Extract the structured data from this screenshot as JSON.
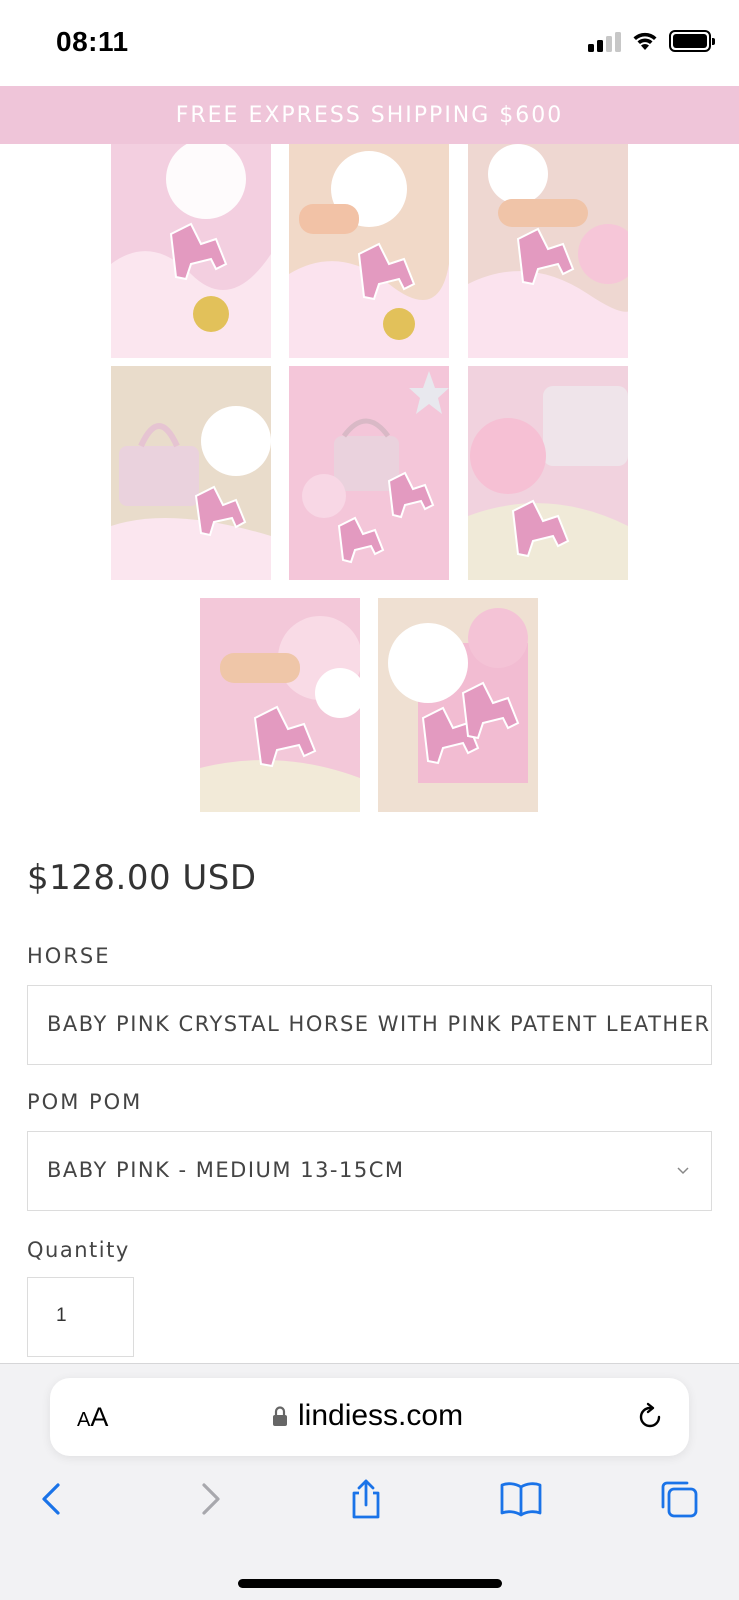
{
  "status_bar": {
    "time": "08:11"
  },
  "announcement": {
    "text": "FREE EXPRESS SHIPPING $600"
  },
  "gallery": {
    "images": [
      {
        "name": "product-image-1"
      },
      {
        "name": "product-image-2"
      },
      {
        "name": "product-image-3"
      },
      {
        "name": "product-image-4"
      },
      {
        "name": "product-image-5"
      },
      {
        "name": "product-image-6"
      },
      {
        "name": "product-image-7"
      },
      {
        "name": "product-image-8"
      }
    ]
  },
  "product": {
    "price": "$128.00 USD",
    "horse_label": "HORSE",
    "horse_value": "BABY PINK CRYSTAL HORSE WITH PINK PATENT LEATHER",
    "pompom_label": "POM POM",
    "pompom_value": "BABY PINK - MEDIUM 13-15CM",
    "quantity_label": "Quantity",
    "quantity_value": "1"
  },
  "browser": {
    "text_size_small": "A",
    "text_size_big": "A",
    "domain": "lindiess.com",
    "icons": [
      "lock-icon",
      "reload-icon",
      "back-icon",
      "forward-icon",
      "share-icon",
      "bookmarks-icon",
      "tabs-icon"
    ]
  },
  "colors": {
    "announcement_bg": "#efc5d9",
    "accent_blue": "#1a73e8",
    "thumb_pink": "#f4c6d9"
  }
}
